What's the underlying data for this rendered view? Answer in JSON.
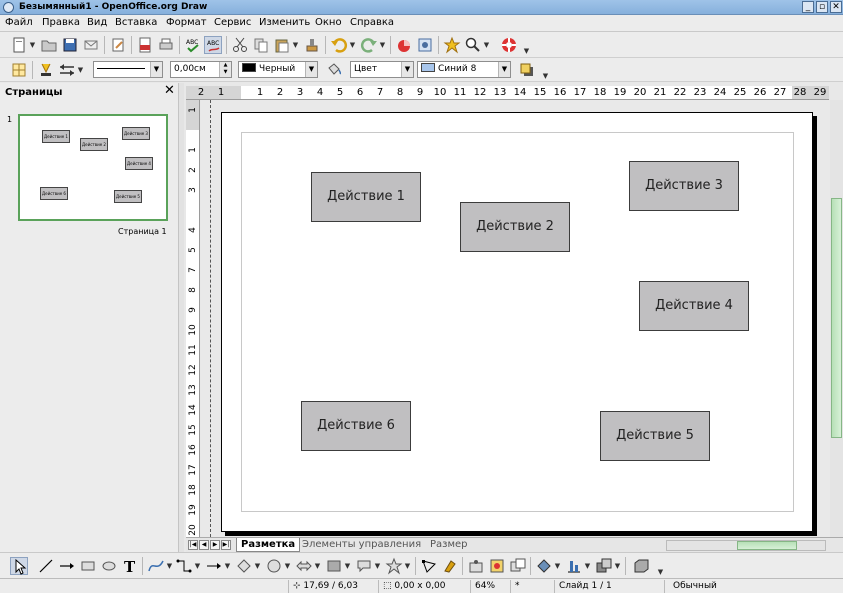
{
  "window": {
    "title": "Безымянный1 - OpenOffice.org Draw",
    "controls": [
      "_",
      "▫",
      "✕"
    ]
  },
  "menu": [
    "Файл",
    "Правка",
    "Вид",
    "Вставка",
    "Формат",
    "Сервис",
    "Изменить",
    "Окно",
    "Справка"
  ],
  "format_toolbar": {
    "line_width": "0,00см",
    "line_color": "Черный",
    "area_style": "Цвет",
    "area_color": "Синий 8",
    "colors": {
      "line": "#000000",
      "area": "#a8c6ec"
    }
  },
  "pages_panel": {
    "title": "Страницы",
    "close": "✕",
    "page_number": "1",
    "page_label": "Страница 1",
    "thumb_boxes": [
      "Действие 1",
      "Действие 2",
      "Действие 3",
      "Действие 4",
      "Действие 5",
      "Действие 6"
    ]
  },
  "rulers": {
    "horizontal": [
      "2",
      "1",
      "1",
      "2",
      "3",
      "4",
      "5",
      "6",
      "7",
      "8",
      "9",
      "10",
      "11",
      "12",
      "13",
      "14",
      "15",
      "16",
      "17",
      "18",
      "19",
      "20",
      "21",
      "22",
      "23",
      "24",
      "25",
      "26",
      "27",
      "28",
      "29"
    ],
    "vertical": [
      "1",
      "1",
      "2",
      "3",
      "4",
      "5",
      "7",
      "8",
      "9",
      "10",
      "11",
      "12",
      "13",
      "14",
      "15",
      "16",
      "17",
      "18",
      "19",
      "20"
    ]
  },
  "shapes": [
    "Действие 1",
    "Действие 2",
    "Действие 3",
    "Действие 4",
    "Действие 6",
    "Действие 5"
  ],
  "tabs": [
    "Разметка",
    "Элементы управления",
    "Размер"
  ],
  "status": {
    "position": "17,69 / 6,03",
    "size": "0,00 x 0,00",
    "zoom": "64%",
    "modified": "*",
    "slide": "Слайд 1 / 1",
    "layout": "Обычный"
  }
}
